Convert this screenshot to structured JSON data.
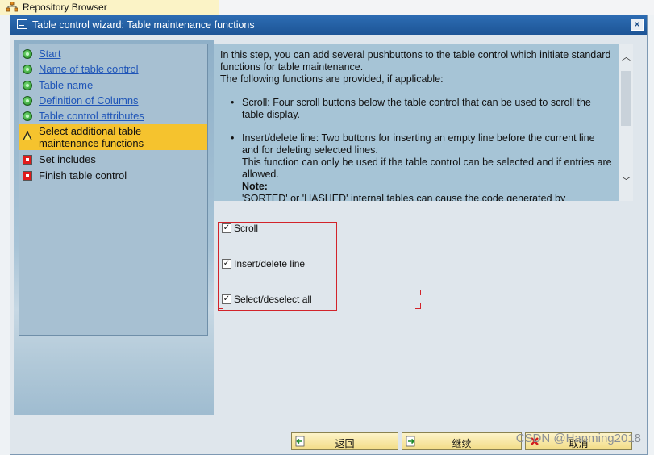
{
  "background_app": {
    "tab_label": "Repository Browser"
  },
  "dialog": {
    "title": "Table control wizard: Table maintenance functions",
    "close_symbol": "×"
  },
  "steps": [
    {
      "label": "Start",
      "status": "done",
      "link": true
    },
    {
      "label": "Name of table control",
      "status": "done",
      "link": true
    },
    {
      "label": "Table name",
      "status": "done",
      "link": true
    },
    {
      "label": "Definition of Columns",
      "status": "done",
      "link": true
    },
    {
      "label": "Table control attributes",
      "status": "done",
      "link": true
    },
    {
      "label": "Select additional table maintenance functions",
      "status": "current",
      "link": false
    },
    {
      "label": "Set includes",
      "status": "pending",
      "link": false
    },
    {
      "label": "Finish table control",
      "status": "pending",
      "link": false
    }
  ],
  "info": {
    "intro_1": "In this step, you can add several pushbuttons to the table control which initiate standard functions for table maintenance.",
    "intro_2": "The following functions are provided, if applicable:",
    "bullet_1": "Scroll: Four scroll buttons below the table control that can be used to scroll the table display.",
    "bullet_2": "Insert/delete line: Two buttons for inserting an empty line before the current line and for deleting selected lines.",
    "bullet_2_more": "This function can only be used if the table control can be selected and if entries are allowed.",
    "note_label": "Note:",
    "note_text": "'SORTED' or 'HASHED' internal tables can cause the code generated by"
  },
  "options": [
    {
      "label": "Scroll",
      "checked": true
    },
    {
      "label": "Insert/delete line",
      "checked": true
    },
    {
      "label": "Select/deselect all",
      "checked": true
    }
  ],
  "buttons": {
    "back": "返回",
    "continue": "继续",
    "cancel": "取消"
  },
  "watermark": "CSDN @Hanming2018",
  "colors": {
    "title_bar": "#1d5596",
    "active_step": "#f5c32e",
    "highlight_border": "#d2232a"
  }
}
